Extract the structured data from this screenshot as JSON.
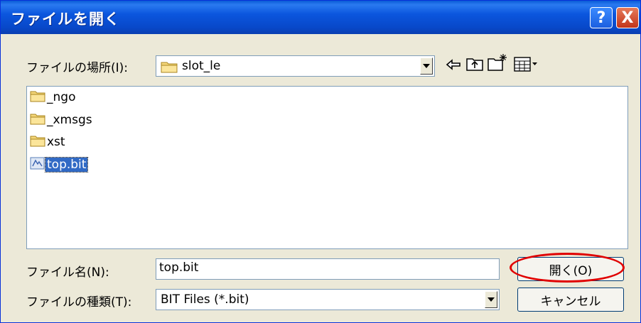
{
  "dialog": {
    "title": "ファイルを開く"
  },
  "titlebar_buttons": {
    "help": "?",
    "close": "X"
  },
  "location": {
    "label": "ファイルの場所(I):",
    "value": "slot_le"
  },
  "files": [
    {
      "name": "_ngo",
      "type": "folder"
    },
    {
      "name": "_xmsgs",
      "type": "folder"
    },
    {
      "name": "xst",
      "type": "folder"
    },
    {
      "name": "top.bit",
      "type": "file",
      "selected": true
    }
  ],
  "filename": {
    "label": "ファイル名(N):",
    "value": "top.bit"
  },
  "filetype": {
    "label": "ファイルの種類(T):",
    "value": "BIT Files (*.bit)"
  },
  "buttons": {
    "open": "開く(O)",
    "cancel": "キャンセル"
  },
  "colors": {
    "selection": "#316ac5",
    "highlight_ring": "#e00000",
    "titlebar": "#0a5bd6"
  }
}
